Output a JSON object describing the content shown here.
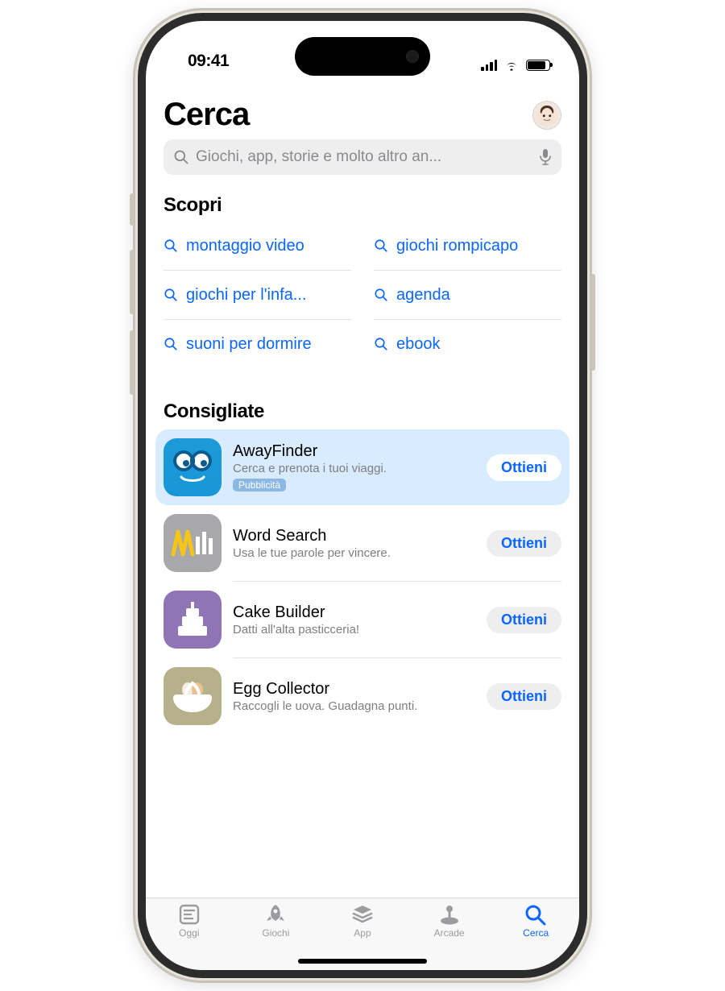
{
  "status": {
    "time": "09:41"
  },
  "header": {
    "title": "Cerca"
  },
  "search": {
    "placeholder": "Giochi, app, storie e molto altro an..."
  },
  "discover": {
    "heading": "Scopri",
    "items": [
      "montaggio video",
      "giochi rompicapo",
      "giochi per l'infa...",
      "agenda",
      "suoni per dormire",
      "ebook"
    ]
  },
  "suggested": {
    "heading": "Consigliate",
    "ad_label": "Pubblicità",
    "get_label": "Ottieni",
    "apps": [
      {
        "name": "AwayFinder",
        "subtitle": "Cerca e prenota i tuoi viaggi.",
        "is_ad": true
      },
      {
        "name": "Word Search",
        "subtitle": "Usa le tue parole per vincere.",
        "is_ad": false
      },
      {
        "name": "Cake Builder",
        "subtitle": "Datti all'alta pasticceria!",
        "is_ad": false
      },
      {
        "name": "Egg Collector",
        "subtitle": "Raccogli le uova. Guadagna punti.",
        "is_ad": false
      }
    ]
  },
  "tabs": {
    "items": [
      {
        "label": "Oggi"
      },
      {
        "label": "Giochi"
      },
      {
        "label": "App"
      },
      {
        "label": "Arcade"
      },
      {
        "label": "Cerca"
      }
    ],
    "active_index": 4
  }
}
